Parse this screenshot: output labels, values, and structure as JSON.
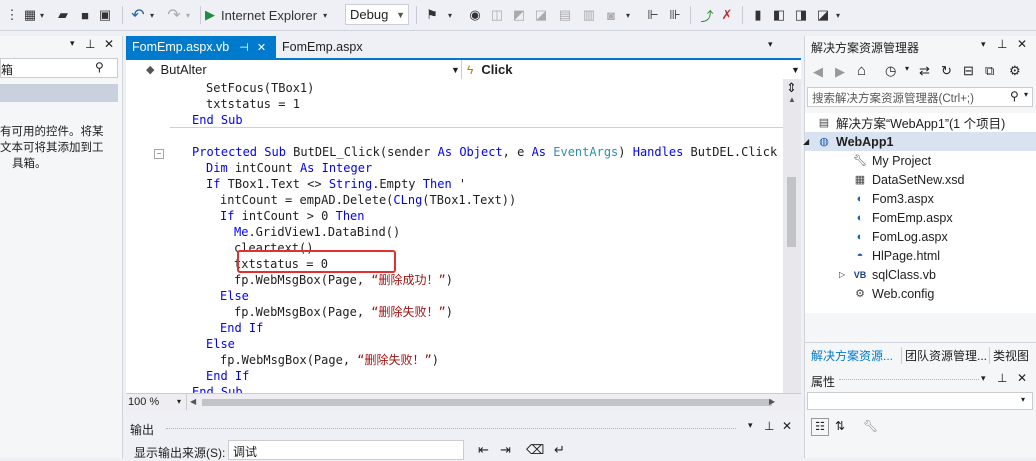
{
  "toolbar": {
    "browser": "Internet Explorer",
    "config": "Debug"
  },
  "left_panel": {
    "search_partial": "箱",
    "message_line1": "有可用的控件。将某",
    "message_line2": "文本可将其添加到工",
    "message_line3": "具箱。"
  },
  "editor": {
    "tabs": [
      {
        "label": "FomEmp.aspx.vb",
        "pin": "⊣",
        "close": "✕"
      },
      {
        "label": "FomEmp.aspx",
        "close": ""
      }
    ],
    "class_combo": "ButAlter",
    "method_combo": "Click",
    "zoom": "100 %",
    "lines": [
      {
        "indent": 6,
        "tokens": [
          {
            "t": "SetFocus(TBox1)",
            "c": ""
          }
        ]
      },
      {
        "indent": 6,
        "tokens": [
          {
            "t": "txtstatus = 1",
            "c": ""
          }
        ]
      },
      {
        "indent": 4,
        "tokens": [
          {
            "t": "End Sub",
            "c": "kw"
          }
        ]
      },
      {
        "indent": 0,
        "tokens": [
          {
            "t": "",
            "c": ""
          }
        ]
      },
      {
        "indent": 4,
        "tokens": [
          {
            "t": "Protected Sub",
            "c": "kw"
          },
          {
            "t": " ButDEL_Click(sender ",
            "c": ""
          },
          {
            "t": "As Object",
            "c": "kw"
          },
          {
            "t": ", e ",
            "c": ""
          },
          {
            "t": "As",
            "c": "kw"
          },
          {
            "t": " EventArgs",
            "c": "ty"
          },
          {
            "t": ") ",
            "c": ""
          },
          {
            "t": "Handles",
            "c": "kw"
          },
          {
            "t": " ButDEL.Click",
            "c": ""
          }
        ]
      },
      {
        "indent": 6,
        "tokens": [
          {
            "t": "Dim",
            "c": "kw"
          },
          {
            "t": " intCount ",
            "c": ""
          },
          {
            "t": "As Integer",
            "c": "kw"
          }
        ]
      },
      {
        "indent": 6,
        "tokens": [
          {
            "t": "If",
            "c": "kw"
          },
          {
            "t": " TBox1.Text <> ",
            "c": ""
          },
          {
            "t": "String",
            "c": "kw"
          },
          {
            "t": ".Empty ",
            "c": ""
          },
          {
            "t": "Then",
            "c": "kw"
          },
          {
            "t": " '",
            "c": ""
          }
        ]
      },
      {
        "indent": 8,
        "tokens": [
          {
            "t": "intCount = empAD.Delete(",
            "c": ""
          },
          {
            "t": "CLng",
            "c": "kw"
          },
          {
            "t": "(TBox1.Text))",
            "c": ""
          }
        ]
      },
      {
        "indent": 8,
        "tokens": [
          {
            "t": "If",
            "c": "kw"
          },
          {
            "t": " intCount > 0 ",
            "c": ""
          },
          {
            "t": "Then",
            "c": "kw"
          }
        ]
      },
      {
        "indent": 10,
        "tokens": [
          {
            "t": "Me",
            "c": "kw"
          },
          {
            "t": ".GridView1.DataBind()",
            "c": ""
          }
        ]
      },
      {
        "indent": 10,
        "tokens": [
          {
            "t": "cleartext()",
            "c": ""
          }
        ]
      },
      {
        "indent": 10,
        "tokens": [
          {
            "t": "txtstatus = 0",
            "c": ""
          }
        ]
      },
      {
        "indent": 10,
        "tokens": [
          {
            "t": "fp.WebMsgBox(Page, ",
            "c": ""
          },
          {
            "t": "“删除成功！”",
            "c": "st"
          },
          {
            "t": ")",
            "c": ""
          }
        ]
      },
      {
        "indent": 8,
        "tokens": [
          {
            "t": "Else",
            "c": "kw"
          }
        ]
      },
      {
        "indent": 10,
        "tokens": [
          {
            "t": "fp.WebMsgBox(Page, ",
            "c": ""
          },
          {
            "t": "“删除失败！”",
            "c": "st"
          },
          {
            "t": ")",
            "c": ""
          }
        ]
      },
      {
        "indent": 8,
        "tokens": [
          {
            "t": "End If",
            "c": "kw"
          }
        ]
      },
      {
        "indent": 6,
        "tokens": [
          {
            "t": "Else",
            "c": "kw"
          }
        ]
      },
      {
        "indent": 8,
        "tokens": [
          {
            "t": "fp.WebMsgBox(Page, ",
            "c": ""
          },
          {
            "t": "“删除失败！”",
            "c": "st"
          },
          {
            "t": ")",
            "c": ""
          }
        ]
      },
      {
        "indent": 6,
        "tokens": [
          {
            "t": "End If",
            "c": "kw"
          }
        ]
      },
      {
        "indent": 4,
        "tokens": [
          {
            "t": "End Sub",
            "c": "kw"
          }
        ]
      }
    ]
  },
  "output": {
    "title": "输出",
    "source_label": "显示输出来源(S):",
    "source_value": "调试"
  },
  "solution": {
    "title": "解决方案资源管理器",
    "search_placeholder": "搜索解决方案资源管理器(Ctrl+;)",
    "items": [
      {
        "label": "解决方案“WebApp1”(1 个项目)",
        "icon": "solution-icon",
        "bold": false
      },
      {
        "label": "WebApp1",
        "icon": "web-project-icon",
        "bold": true
      },
      {
        "label": "My Project",
        "icon": "wrench-icon",
        "bold": false
      },
      {
        "label": "DataSetNew.xsd",
        "icon": "dataset-icon",
        "bold": false
      },
      {
        "label": "Fom3.aspx",
        "icon": "aspx-icon",
        "bold": false
      },
      {
        "label": "FomEmp.aspx",
        "icon": "aspx-icon",
        "bold": false
      },
      {
        "label": "FomLog.aspx",
        "icon": "aspx-icon",
        "bold": false
      },
      {
        "label": "HlPage.html",
        "icon": "html-icon",
        "bold": false
      },
      {
        "label": "sqlClass.vb",
        "icon": "vb-icon",
        "bold": false
      },
      {
        "label": "Web.config",
        "icon": "config-icon",
        "bold": false
      }
    ],
    "bottom_tabs": [
      "解决方案资源...",
      "团队资源管理...",
      "类视图"
    ]
  },
  "properties": {
    "title": "属性"
  },
  "colors": {
    "accent": "#007acc",
    "keyword": "#0000ff",
    "type": "#2b91af",
    "string": "#a31515",
    "highlight_box": "#e03030"
  }
}
